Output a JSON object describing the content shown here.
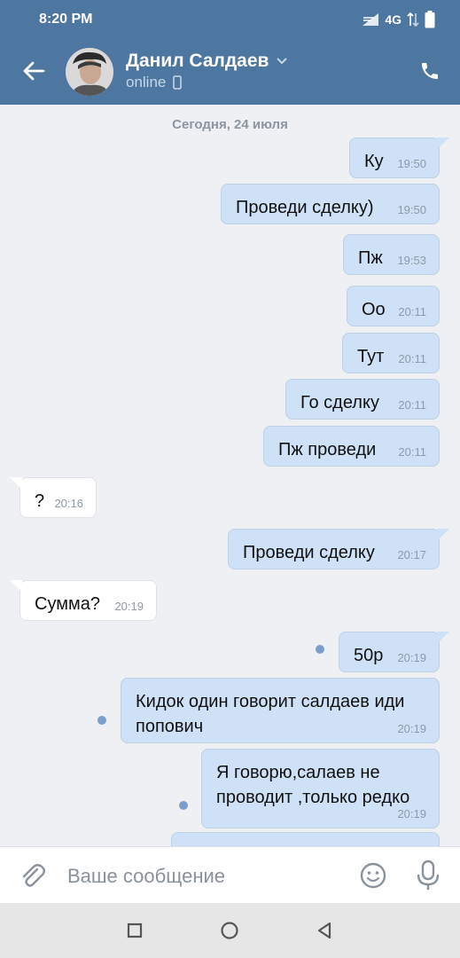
{
  "status_bar": {
    "time": "8:20 PM",
    "network": "4G"
  },
  "header": {
    "name": "Данил Салдаев",
    "status": "online"
  },
  "chat": {
    "date": "Сегодня, 24 июля",
    "messages": [
      {
        "dir": "out",
        "text": "Ку",
        "time": "19:50"
      },
      {
        "dir": "out",
        "text": "Проведи сделку)",
        "time": "19:50"
      },
      {
        "dir": "out",
        "text": "Пж",
        "time": "19:53"
      },
      {
        "dir": "out",
        "text": "Оо",
        "time": "20:11"
      },
      {
        "dir": "out",
        "text": "Тут",
        "time": "20:11"
      },
      {
        "dir": "out",
        "text": "Го сделку",
        "time": "20:11"
      },
      {
        "dir": "out",
        "text": "Пж проведи",
        "time": "20:11"
      },
      {
        "dir": "in",
        "text": "?",
        "time": "20:16"
      },
      {
        "dir": "out",
        "text": "Проведи сделку",
        "time": "20:17"
      },
      {
        "dir": "in",
        "text": "Сумма?",
        "time": "20:19"
      },
      {
        "dir": "out",
        "text": "50р",
        "time": "20:19",
        "unread": true
      },
      {
        "dir": "out",
        "text": "Кидок один говорит салдаев иди попович",
        "time": "20:19",
        "unread": true
      },
      {
        "dir": "out",
        "text": "Я говорю,салаев не проводит ,только редко",
        "time": "20:19",
        "unread": true
      }
    ]
  },
  "input": {
    "placeholder": "Ваше сообщение"
  },
  "colors": {
    "header": "#4d76a1",
    "outgoing_bubble": "#cfe1f6",
    "incoming_bubble": "#ffffff",
    "background": "#eef0f3"
  }
}
